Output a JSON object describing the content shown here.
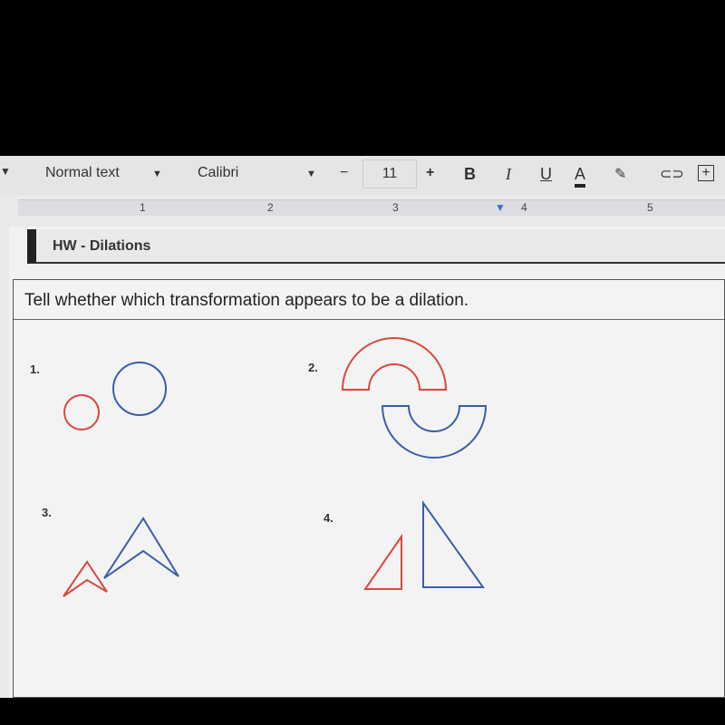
{
  "toolbar": {
    "style": "Normal text",
    "font": "Calibri",
    "size": "11",
    "minus": "−",
    "plus": "+",
    "bold": "B",
    "italic": "I",
    "underline": "U",
    "text_color": "A"
  },
  "ruler": [
    "1",
    "2",
    "3",
    "4",
    "5"
  ],
  "doc": {
    "title": "HW - Dilations",
    "question": "Tell whether which transformation appears to be a dilation.",
    "problems": [
      "1.",
      "2.",
      "3.",
      "4."
    ]
  },
  "colors": {
    "red": "#d9473c",
    "blue": "#3a5ea8"
  }
}
